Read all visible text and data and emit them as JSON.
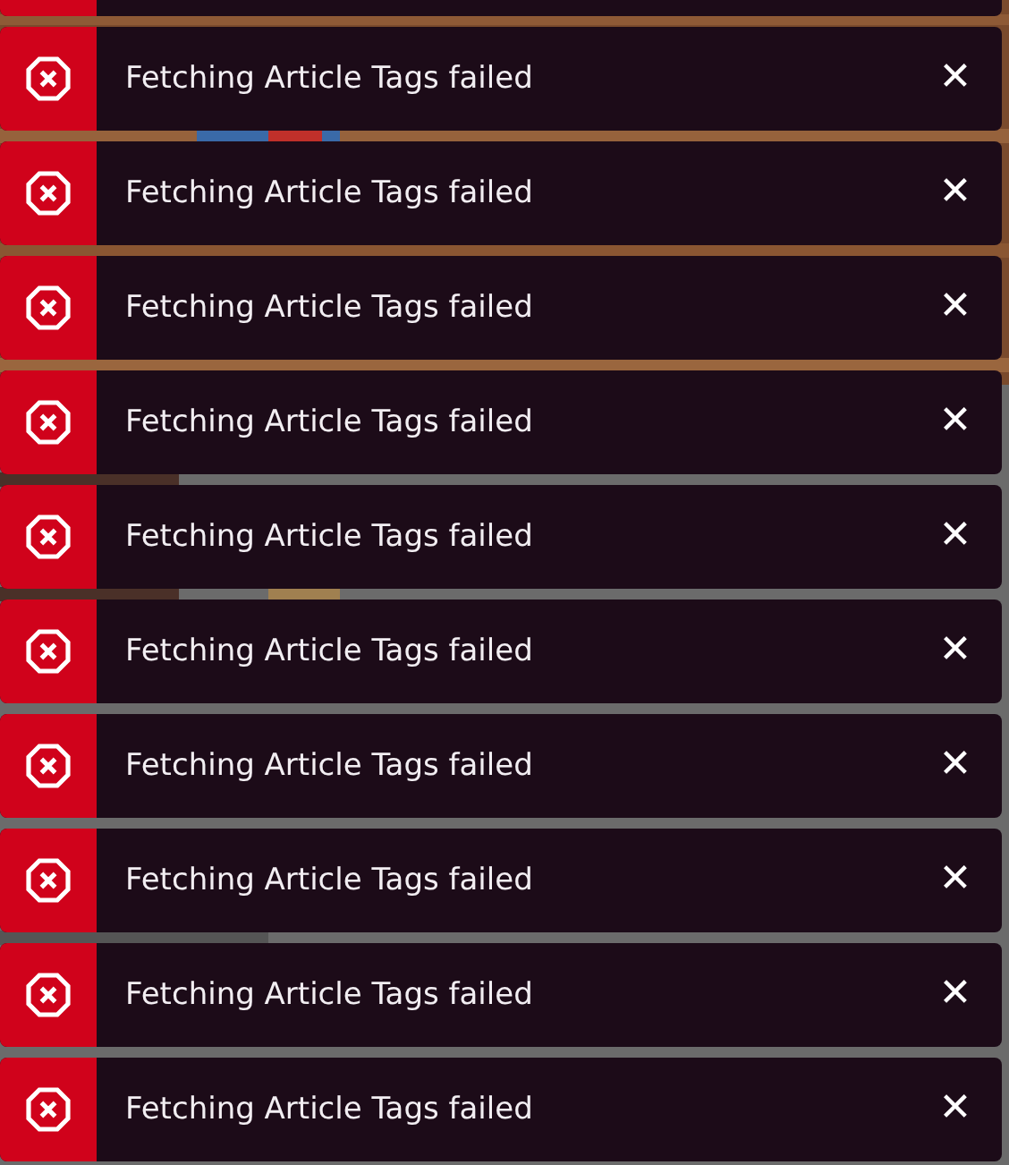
{
  "clipped_toast": {
    "kind": "error"
  },
  "toasts": [
    {
      "kind": "error",
      "message": "Fetching Article Tags failed",
      "close": "✕"
    },
    {
      "kind": "error",
      "message": "Fetching Article Tags failed",
      "close": "✕"
    },
    {
      "kind": "error",
      "message": "Fetching Article Tags failed",
      "close": "✕"
    },
    {
      "kind": "error",
      "message": "Fetching Article Tags failed",
      "close": "✕"
    },
    {
      "kind": "error",
      "message": "Fetching Article Tags failed",
      "close": "✕"
    },
    {
      "kind": "error",
      "message": "Fetching Article Tags failed",
      "close": "✕"
    },
    {
      "kind": "error",
      "message": "Fetching Article Tags failed",
      "close": "✕"
    },
    {
      "kind": "error",
      "message": "Fetching Article Tags failed",
      "close": "✕"
    },
    {
      "kind": "error",
      "message": "Fetching Article Tags failed",
      "close": "✕"
    },
    {
      "kind": "error",
      "message": "Fetching Article Tags failed",
      "close": "✕"
    }
  ]
}
